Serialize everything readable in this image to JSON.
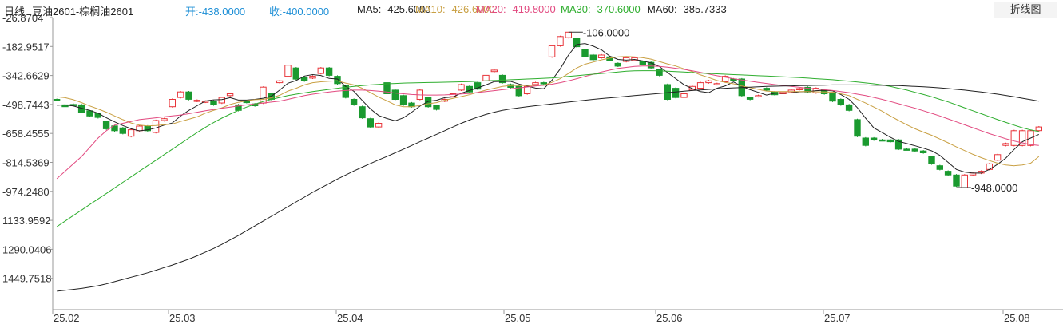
{
  "header": {
    "period_label": "日线",
    "instrument": "豆油2601-棕榈油2601",
    "open": "开:-438.0000",
    "close": "收:-400.0000",
    "ma5": "MA5: -425.6000",
    "ma10": "MA10: -426.6000",
    "ma20": "MA20: -419.8000",
    "ma30": "MA30: -370.6000",
    "ma60": "MA60: -385.7333",
    "toggle_button": "折线图"
  },
  "colors": {
    "up": "#e8353a",
    "down": "#1a9a2f",
    "ma5": "#222222",
    "ma10": "#c9a043",
    "ma20": "#e24a80",
    "ma30": "#2fae2f",
    "ma60": "#222222",
    "open_text": "#1e8fd6",
    "close_text": "#1e8fd6"
  },
  "chart_data": {
    "type": "candlestick",
    "y_ticks": [
      "-26.8704",
      "-182.9517",
      "-342.6629",
      "-498.7443",
      "-658.4555",
      "-814.5369",
      "-974.2480",
      "1133.9592",
      "1290.0406",
      "1449.7518"
    ],
    "x_ticks": [
      "25.02",
      "25.03",
      "25.04",
      "25.05",
      "25.06",
      "25.07",
      "25.08"
    ],
    "ylim": [
      -1550,
      -27
    ],
    "annotations": [
      {
        "label": "-106.0000",
        "value": -106
      },
      {
        "label": "-948.0000",
        "value": -948
      }
    ],
    "candles": [
      [
        -470,
        -470,
        -466,
        -480
      ],
      [
        -500,
        -510,
        -496,
        -514
      ],
      [
        -498,
        -500,
        -492,
        -505
      ],
      [
        -500,
        -540,
        -495,
        -545
      ],
      [
        -532,
        -560,
        -528,
        -566
      ],
      [
        -548,
        -568,
        -545,
        -574
      ],
      [
        -590,
        -630,
        -585,
        -636
      ],
      [
        -614,
        -640,
        -608,
        -646
      ],
      [
        -625,
        -655,
        -620,
        -660
      ],
      [
        -670,
        -635,
        -628,
        -676
      ],
      [
        -640,
        -615,
        -610,
        -645
      ],
      [
        -615,
        -640,
        -610,
        -645
      ],
      [
        -650,
        -585,
        -580,
        -655
      ],
      [
        -585,
        -575,
        -570,
        -590
      ],
      [
        -510,
        -470,
        -465,
        -515
      ],
      [
        -460,
        -430,
        -425,
        -465
      ],
      [
        -430,
        -470,
        -425,
        -475
      ],
      [
        -480,
        -475,
        -470,
        -485
      ],
      [
        -485,
        -480,
        -475,
        -490
      ],
      [
        -480,
        -500,
        -475,
        -505
      ],
      [
        -490,
        -460,
        -455,
        -495
      ],
      [
        -450,
        -440,
        -435,
        -455
      ],
      [
        -500,
        -530,
        -495,
        -535
      ],
      [
        -480,
        -488,
        -475,
        -492
      ],
      [
        -495,
        -505,
        -490,
        -510
      ],
      [
        -490,
        -404,
        -400,
        -495
      ],
      [
        -440,
        -470,
        -435,
        -475
      ],
      [
        -380,
        -370,
        -365,
        -385
      ],
      [
        -345,
        -285,
        -280,
        -350
      ],
      [
        -300,
        -360,
        -295,
        -365
      ],
      [
        -350,
        -370,
        -345,
        -375
      ],
      [
        -355,
        -345,
        -340,
        -360
      ],
      [
        -330,
        -300,
        -295,
        -335
      ],
      [
        -300,
        -340,
        -295,
        -345
      ],
      [
        -345,
        -385,
        -340,
        -390
      ],
      [
        -395,
        -460,
        -390,
        -465
      ],
      [
        -470,
        -500,
        -465,
        -505
      ],
      [
        -510,
        -570,
        -505,
        -575
      ],
      [
        -575,
        -620,
        -570,
        -625
      ],
      [
        -620,
        -600,
        -595,
        -625
      ],
      [
        -380,
        -440,
        -375,
        -445
      ],
      [
        -420,
        -470,
        -415,
        -475
      ],
      [
        -450,
        -500,
        -445,
        -505
      ],
      [
        -490,
        -510,
        -485,
        -515
      ],
      [
        -470,
        -420,
        -415,
        -475
      ],
      [
        -460,
        -510,
        -455,
        -515
      ],
      [
        -505,
        -525,
        -500,
        -530
      ],
      [
        -480,
        -470,
        -465,
        -485
      ],
      [
        -455,
        -440,
        -435,
        -460
      ],
      [
        -420,
        -390,
        -385,
        -425
      ],
      [
        -400,
        -430,
        -395,
        -435
      ],
      [
        -380,
        -415,
        -375,
        -420
      ],
      [
        -370,
        -340,
        -335,
        -375
      ],
      [
        -320,
        -312,
        -308,
        -325
      ],
      [
        -340,
        -380,
        -335,
        -385
      ],
      [
        -390,
        -405,
        -385,
        -410
      ],
      [
        -400,
        -450,
        -395,
        -455
      ],
      [
        -440,
        -400,
        -395,
        -445
      ],
      [
        -390,
        -380,
        -375,
        -395
      ],
      [
        -380,
        -385,
        -375,
        -390
      ],
      [
        -240,
        -180,
        -175,
        -245
      ],
      [
        -180,
        -130,
        -125,
        -185
      ],
      [
        -136,
        -106,
        -106,
        -140
      ],
      [
        -140,
        -185,
        -135,
        -190
      ],
      [
        -200,
        -240,
        -195,
        -245
      ],
      [
        -230,
        -255,
        -225,
        -260
      ],
      [
        -245,
        -230,
        -225,
        -250
      ],
      [
        -240,
        -260,
        -235,
        -265
      ],
      [
        -275,
        -290,
        -270,
        -295
      ],
      [
        -265,
        -245,
        -240,
        -270
      ],
      [
        -260,
        -245,
        -240,
        -265
      ],
      [
        -265,
        -280,
        -260,
        -285
      ],
      [
        -270,
        -300,
        -265,
        -305
      ],
      [
        -310,
        -340,
        -305,
        -345
      ],
      [
        -390,
        -470,
        -385,
        -475
      ],
      [
        -410,
        -460,
        -405,
        -465
      ],
      [
        -460,
        -440,
        -435,
        -465
      ],
      [
        -420,
        -400,
        -395,
        -425
      ],
      [
        -410,
        -380,
        -375,
        -415
      ],
      [
        -380,
        -370,
        -365,
        -385
      ],
      [
        -390,
        -385,
        -380,
        -395
      ],
      [
        -375,
        -345,
        -340,
        -380
      ],
      [
        -360,
        -360,
        -355,
        -365
      ],
      [
        -360,
        -450,
        -355,
        -455
      ],
      [
        -460,
        -470,
        -455,
        -475
      ],
      [
        -455,
        -450,
        -445,
        -460
      ],
      [
        -410,
        -420,
        -405,
        -425
      ],
      [
        -430,
        -445,
        -425,
        -450
      ],
      [
        -440,
        -430,
        -425,
        -445
      ],
      [
        -430,
        -420,
        -415,
        -435
      ],
      [
        -418,
        -412,
        -408,
        -422
      ],
      [
        -405,
        -430,
        -400,
        -435
      ],
      [
        -435,
        -410,
        -405,
        -440
      ],
      [
        -420,
        -440,
        -415,
        -445
      ],
      [
        -440,
        -480,
        -435,
        -485
      ],
      [
        -470,
        -500,
        -465,
        -505
      ],
      [
        -500,
        -530,
        -495,
        -535
      ],
      [
        -580,
        -670,
        -575,
        -675
      ],
      [
        -680,
        -720,
        -675,
        -725
      ],
      [
        -680,
        -690,
        -675,
        -695
      ],
      [
        -690,
        -690,
        -685,
        -695
      ],
      [
        -690,
        -700,
        -685,
        -705
      ],
      [
        -690,
        -740,
        -685,
        -745
      ],
      [
        -740,
        -740,
        -735,
        -745
      ],
      [
        -740,
        -750,
        -735,
        -755
      ],
      [
        -750,
        -760,
        -745,
        -765
      ],
      [
        -780,
        -820,
        -775,
        -825
      ],
      [
        -830,
        -850,
        -825,
        -855
      ],
      [
        -860,
        -880,
        -855,
        -885
      ],
      [
        -880,
        -940,
        -875,
        -945
      ],
      [
        -948,
        -880,
        -875,
        -948
      ],
      [
        -880,
        -870,
        -865,
        -885
      ],
      [
        -870,
        -860,
        -855,
        -875
      ],
      [
        -850,
        -820,
        -815,
        -855
      ],
      [
        -800,
        -770,
        -765,
        -805
      ],
      [
        -720,
        -710,
        -705,
        -725
      ],
      [
        -720,
        -640,
        -635,
        -725
      ],
      [
        -720,
        -640,
        -635,
        -725
      ],
      [
        -720,
        -640,
        -635,
        -725
      ],
      [
        -640,
        -620,
        -615,
        -645
      ]
    ],
    "ma_series": [
      {
        "name": "MA5",
        "values": [
          -502,
          -500,
          -506,
          -518,
          -530,
          -545,
          -570,
          -592,
          -612,
          -630,
          -641,
          -636,
          -625,
          -610,
          -598,
          -560,
          -530,
          -505,
          -479,
          -473,
          -471,
          -461,
          -474,
          -474,
          -470,
          -464,
          -453,
          -420,
          -383,
          -368,
          -344,
          -336,
          -341,
          -357,
          -360,
          -400,
          -427,
          -476,
          -522,
          -558,
          -574,
          -586,
          -570,
          -540,
          -507,
          -481,
          -475,
          -461,
          -457,
          -437,
          -422,
          -408,
          -392,
          -374,
          -373,
          -373,
          -387,
          -398,
          -409,
          -413,
          -366,
          -305,
          -230,
          -173,
          -168,
          -182,
          -202,
          -236,
          -254,
          -258,
          -254,
          -262,
          -273,
          -292,
          -325,
          -358,
          -391,
          -412,
          -428,
          -434,
          -410,
          -397,
          -376,
          -400,
          -418,
          -432,
          -447,
          -437,
          -437,
          -435,
          -429,
          -428,
          -423,
          -421,
          -424,
          -444,
          -470,
          -515,
          -572,
          -625,
          -650,
          -675,
          -698,
          -710,
          -722,
          -735,
          -749,
          -774,
          -812,
          -850,
          -864,
          -870,
          -870,
          -850,
          -822,
          -788,
          -742,
          -700,
          -680,
          -660
        ]
      },
      {
        "name": "MA10",
        "values": [
          -456,
          -461,
          -472,
          -488,
          -506,
          -522,
          -540,
          -560,
          -580,
          -598,
          -610,
          -614,
          -612,
          -608,
          -604,
          -590,
          -578,
          -565,
          -545,
          -530,
          -516,
          -498,
          -486,
          -478,
          -472,
          -470,
          -462,
          -448,
          -425,
          -410,
          -392,
          -380,
          -375,
          -372,
          -370,
          -382,
          -392,
          -410,
          -434,
          -458,
          -478,
          -500,
          -510,
          -510,
          -503,
          -494,
          -488,
          -475,
          -465,
          -455,
          -445,
          -432,
          -420,
          -410,
          -400,
          -395,
          -395,
          -395,
          -395,
          -394,
          -378,
          -358,
          -330,
          -300,
          -280,
          -268,
          -256,
          -247,
          -240,
          -238,
          -240,
          -245,
          -252,
          -265,
          -278,
          -290,
          -305,
          -320,
          -338,
          -352,
          -368,
          -378,
          -386,
          -398,
          -406,
          -416,
          -425,
          -428,
          -428,
          -428,
          -428,
          -428,
          -429,
          -430,
          -431,
          -440,
          -450,
          -470,
          -490,
          -512,
          -534,
          -560,
          -585,
          -608,
          -630,
          -648,
          -665,
          -685,
          -706,
          -728,
          -748,
          -768,
          -786,
          -802,
          -816,
          -826,
          -830,
          -826,
          -816,
          -780
        ]
      },
      {
        "name": "MA20",
        "values": [
          -900,
          -860,
          -820,
          -780,
          -730,
          -680,
          -640,
          -610,
          -600,
          -590,
          -580,
          -575,
          -570,
          -565,
          -560,
          -555,
          -548,
          -540,
          -532,
          -525,
          -518,
          -512,
          -506,
          -500,
          -495,
          -490,
          -485,
          -480,
          -470,
          -460,
          -450,
          -442,
          -436,
          -430,
          -425,
          -422,
          -420,
          -420,
          -422,
          -426,
          -430,
          -436,
          -440,
          -444,
          -446,
          -447,
          -447,
          -446,
          -444,
          -441,
          -438,
          -433,
          -428,
          -423,
          -418,
          -413,
          -408,
          -403,
          -398,
          -393,
          -388,
          -380,
          -370,
          -358,
          -346,
          -334,
          -322,
          -312,
          -303,
          -297,
          -292,
          -290,
          -290,
          -292,
          -296,
          -302,
          -308,
          -316,
          -324,
          -333,
          -342,
          -350,
          -358,
          -365,
          -372,
          -378,
          -384,
          -390,
          -395,
          -400,
          -405,
          -410,
          -414,
          -418,
          -422,
          -428,
          -434,
          -442,
          -450,
          -460,
          -470,
          -482,
          -494,
          -506,
          -518,
          -532,
          -546,
          -560,
          -576,
          -592,
          -608,
          -624,
          -640,
          -656,
          -670,
          -684,
          -696,
          -706,
          -716,
          -720
        ]
      },
      {
        "name": "MA30",
        "values": [
          -1160,
          -1130,
          -1100,
          -1070,
          -1040,
          -1010,
          -980,
          -950,
          -920,
          -890,
          -860,
          -830,
          -800,
          -770,
          -740,
          -710,
          -680,
          -650,
          -622,
          -596,
          -572,
          -550,
          -530,
          -512,
          -496,
          -482,
          -470,
          -460,
          -450,
          -442,
          -435,
          -428,
          -422,
          -416,
          -410,
          -405,
          -400,
          -396,
          -392,
          -389,
          -386,
          -384,
          -382,
          -381,
          -380,
          -379,
          -378,
          -377,
          -376,
          -375,
          -374,
          -372,
          -370,
          -368,
          -366,
          -364,
          -362,
          -360,
          -358,
          -356,
          -354,
          -350,
          -346,
          -342,
          -338,
          -334,
          -330,
          -326,
          -322,
          -318,
          -316,
          -315,
          -315,
          -316,
          -318,
          -320,
          -322,
          -325,
          -328,
          -330,
          -332,
          -334,
          -336,
          -338,
          -340,
          -342,
          -344,
          -346,
          -348,
          -350,
          -352,
          -355,
          -358,
          -361,
          -364,
          -368,
          -372,
          -376,
          -381,
          -386,
          -392,
          -400,
          -410,
          -420,
          -432,
          -444,
          -456,
          -470,
          -484,
          -500,
          -516,
          -532,
          -548,
          -564,
          -580,
          -595,
          -610,
          -624,
          -636,
          -645
        ]
      },
      {
        "name": "MA60",
        "values": [
          -1510,
          -1505,
          -1500,
          -1495,
          -1488,
          -1480,
          -1470,
          -1458,
          -1446,
          -1434,
          -1422,
          -1410,
          -1396,
          -1382,
          -1368,
          -1352,
          -1336,
          -1318,
          -1298,
          -1278,
          -1256,
          -1232,
          -1208,
          -1182,
          -1156,
          -1130,
          -1104,
          -1078,
          -1052,
          -1026,
          -1000,
          -974,
          -950,
          -926,
          -902,
          -880,
          -858,
          -838,
          -818,
          -798,
          -780,
          -760,
          -740,
          -720,
          -700,
          -680,
          -660,
          -640,
          -620,
          -600,
          -582,
          -566,
          -552,
          -540,
          -530,
          -522,
          -516,
          -510,
          -505,
          -500,
          -495,
          -490,
          -485,
          -480,
          -475,
          -470,
          -466,
          -462,
          -458,
          -454,
          -450,
          -446,
          -442,
          -438,
          -434,
          -430,
          -426,
          -422,
          -419,
          -416,
          -413,
          -410,
          -408,
          -406,
          -404,
          -402,
          -400,
          -399,
          -398,
          -397,
          -396,
          -395,
          -394,
          -393,
          -392,
          -392,
          -392,
          -392,
          -392,
          -393,
          -394,
          -395,
          -396,
          -398,
          -400,
          -402,
          -405,
          -408,
          -412,
          -416,
          -420,
          -425,
          -430,
          -436,
          -442,
          -449,
          -456,
          -464,
          -472,
          -480
        ]
      }
    ]
  }
}
